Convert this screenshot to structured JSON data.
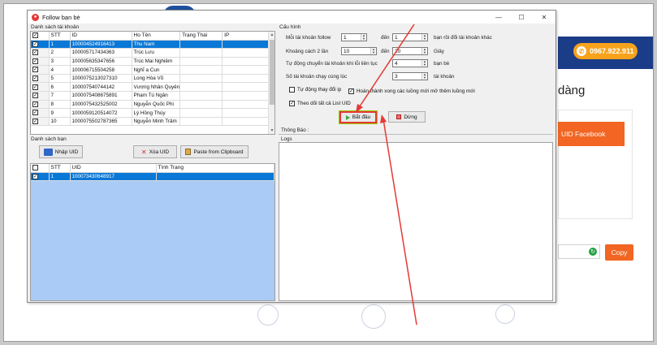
{
  "background": {
    "phone": "0967.922.911",
    "heading": "dàng",
    "uid_button": "UID Facebook",
    "copy_button": "Copy"
  },
  "window": {
    "title": "Follow bạn bè",
    "controls": {
      "minimize": "—",
      "maximize": "☐",
      "close": "✕"
    }
  },
  "accounts": {
    "label": "Danh sách tài khoản",
    "columns": [
      "STT",
      "ID",
      "Ho Tên",
      "Trạng Thái",
      "IP"
    ],
    "rows": [
      {
        "stt": "1",
        "id": "100004524916413",
        "name": "Thu Nam",
        "selected": true
      },
      {
        "stt": "2",
        "id": "100005717434363",
        "name": "Trúc Lưu",
        "selected": false
      },
      {
        "stt": "3",
        "id": "100005635347656",
        "name": "Trúc Mai Nghiêm",
        "selected": false
      },
      {
        "stt": "4",
        "id": "100006715504258",
        "name": "Nghĩ a Cun",
        "selected": false
      },
      {
        "stt": "5",
        "id": "100007521302731​0",
        "name": "Long Hòa Võ",
        "selected": false
      },
      {
        "stt": "6",
        "id": "100007540744142",
        "name": "Vương Nhân Quyên",
        "selected": false
      },
      {
        "stt": "7",
        "id": "100007540867589​1",
        "name": "Phạm Tú Ngân",
        "selected": false
      },
      {
        "stt": "8",
        "id": "100007543252500​2",
        "name": "Nguyễn Quốc Phi",
        "selected": false
      },
      {
        "stt": "9",
        "id": "100005912051407​2",
        "name": "Lý Hồng Thúy",
        "selected": false
      },
      {
        "stt": "10",
        "id": "100007550278736​5",
        "name": "Nguyễn Minh Trâm",
        "selected": false
      }
    ]
  },
  "friends": {
    "label": "Danh sách bạn",
    "import_button": "Nhập UID",
    "delete_button": "Xóa UID",
    "paste_button": "Paste from Clipboard",
    "columns": [
      "STT",
      "UID",
      "Tình Trạng"
    ],
    "rows": [
      {
        "stt": "1",
        "uid": "100073430648917",
        "status": "",
        "selected": true
      }
    ]
  },
  "config": {
    "label": "Cấu hình",
    "follow_per_account_label": "Mỗi tài khoản follow",
    "follow_from": "1",
    "follow_to": "1",
    "to_label": "đến",
    "follow_suffix": "bạn rồi đổi tài khoản khác",
    "delay_label": "Khoảng cách 2 lần",
    "delay_from": "10",
    "delay_to": "20",
    "delay_unit": "Giây",
    "error_switch_label": "Tự động chuyển tài khoản khi lỗi liên tục",
    "error_switch_value": "4",
    "error_switch_unit": "bạn bè",
    "concurrent_label": "Số tài khoản chạy cùng lúc",
    "concurrent_value": "3",
    "concurrent_unit": "tài khoản",
    "auto_ip_label": "Tự động thay đổi ip",
    "auto_ip_checked": false,
    "open_new_thread_label": "Hoàn thành xong các luồng mới mở thêm luồng mới",
    "open_new_thread_checked": true,
    "follow_all_label": "Theo dõi  tất cả List UID",
    "follow_all_checked": true,
    "start_button": "Bắt đầu",
    "stop_button": "Dừng",
    "notice_label": "Thông Báo :",
    "logs_label": "Logs"
  },
  "colors": {
    "selection": "#0a78d7",
    "accent_orange": "#f26522",
    "annotation_red": "#e53935"
  }
}
